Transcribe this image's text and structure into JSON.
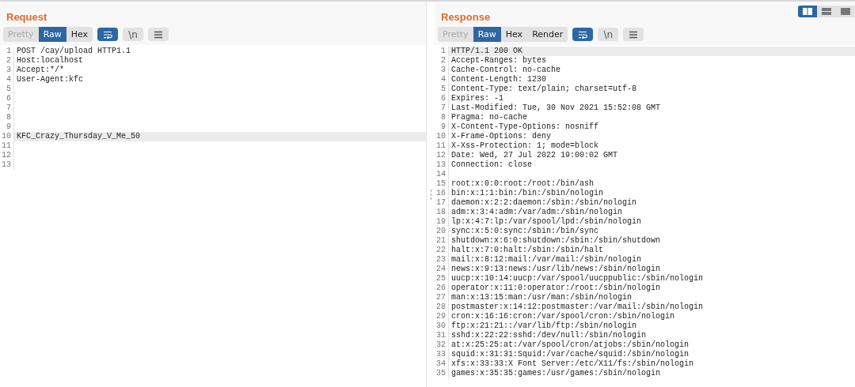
{
  "layout_buttons": [
    {
      "kind": "columns",
      "selected": true
    },
    {
      "kind": "rows",
      "selected": false
    },
    {
      "kind": "single",
      "selected": false
    }
  ],
  "panes": [
    {
      "title": "Request",
      "view_tabs": [
        {
          "label": "Pretty",
          "selected": false,
          "disabled": true
        },
        {
          "label": "Raw",
          "selected": true,
          "disabled": false
        },
        {
          "label": "Hex",
          "selected": false,
          "disabled": false
        }
      ],
      "tools": [
        {
          "kind": "wrap",
          "selected": true
        },
        {
          "kind": "newline",
          "label": "\\n",
          "selected": false
        },
        {
          "kind": "menu",
          "selected": false
        }
      ],
      "lines": [
        {
          "number": "1",
          "text": "POST /cay/upload HTTP1.1",
          "highlighted": false
        },
        {
          "number": "2",
          "text": "Host:localhost",
          "highlighted": false
        },
        {
          "number": "3",
          "text": "Accept:*/*",
          "highlighted": false
        },
        {
          "number": "4",
          "text": "User-Agent:kfc",
          "highlighted": false
        },
        {
          "number": "5",
          "highlighted": false
        },
        {
          "number": "6",
          "highlighted": false
        },
        {
          "number": "7",
          "highlighted": false
        },
        {
          "number": "8",
          "highlighted": false
        },
        {
          "number": "9",
          "highlighted": false
        },
        {
          "number": "10",
          "text": "KFC_Crazy_Thursday_V_Me_50",
          "highlighted": true
        },
        {
          "number": "11",
          "highlighted": false
        },
        {
          "number": "12",
          "highlighted": false
        },
        {
          "number": "13",
          "highlighted": false
        }
      ]
    },
    {
      "title": "Response",
      "view_tabs": [
        {
          "label": "Pretty",
          "selected": false,
          "disabled": true
        },
        {
          "label": "Raw",
          "selected": true,
          "disabled": false
        },
        {
          "label": "Hex",
          "selected": false,
          "disabled": false
        },
        {
          "label": "Render",
          "selected": false,
          "disabled": false
        }
      ],
      "tools": [
        {
          "kind": "wrap",
          "selected": true
        },
        {
          "kind": "newline",
          "label": "\\n",
          "selected": false
        },
        {
          "kind": "menu",
          "selected": false
        }
      ],
      "lines": [
        {
          "number": "1",
          "text": "HTTP/1.1 200 OK",
          "highlighted": true
        },
        {
          "number": "2",
          "text": "Accept-Ranges: bytes",
          "highlighted": false
        },
        {
          "number": "3",
          "text": "Cache-Control: no-cache",
          "highlighted": false
        },
        {
          "number": "4",
          "text": "Content-Length: 1230",
          "highlighted": false
        },
        {
          "number": "5",
          "text": "Content-Type: text/plain; charset=utf-8",
          "highlighted": false
        },
        {
          "number": "6",
          "text": "Expires: -1",
          "highlighted": false
        },
        {
          "number": "7",
          "text": "Last-Modified: Tue, 30 Nov 2021 15:52:08 GMT",
          "highlighted": false
        },
        {
          "number": "8",
          "text": "Pragma: no-cache",
          "highlighted": false
        },
        {
          "number": "9",
          "text": "X-Content-Type-Options: nosniff",
          "highlighted": false
        },
        {
          "number": "10",
          "text": "X-Frame-Options: deny",
          "highlighted": false
        },
        {
          "number": "11",
          "text": "X-Xss-Protection: 1; mode=block",
          "highlighted": false
        },
        {
          "number": "12",
          "text": "Date: Wed, 27 Jul 2022 19:00:02 GMT",
          "highlighted": false
        },
        {
          "number": "13",
          "text": "Connection: close",
          "highlighted": false
        },
        {
          "number": "14",
          "highlighted": false
        },
        {
          "number": "15",
          "text": "root:x:0:0:root:/root:/bin/ash",
          "highlighted": false
        },
        {
          "number": "16",
          "text": "bin:x:1:1:bin:/bin:/sbin/nologin",
          "highlighted": false
        },
        {
          "number": "17",
          "text": "daemon:x:2:2:daemon:/sbin:/sbin/nologin",
          "highlighted": false
        },
        {
          "number": "18",
          "text": "adm:x:3:4:adm:/var/adm:/sbin/nologin",
          "highlighted": false
        },
        {
          "number": "19",
          "text": "lp:x:4:7:lp:/var/spool/lpd:/sbin/nologin",
          "highlighted": false
        },
        {
          "number": "20",
          "text": "sync:x:5:0:sync:/sbin:/bin/sync",
          "highlighted": false
        },
        {
          "number": "21",
          "text": "shutdown:x:6:0:shutdown:/sbin:/sbin/shutdown",
          "highlighted": false
        },
        {
          "number": "22",
          "text": "halt:x:7:0:halt:/sbin:/sbin/halt",
          "highlighted": false
        },
        {
          "number": "23",
          "text": "mail:x:8:12:mail:/var/mail:/sbin/nologin",
          "highlighted": false
        },
        {
          "number": "24",
          "text": "news:x:9:13:news:/usr/lib/news:/sbin/nologin",
          "highlighted": false
        },
        {
          "number": "25",
          "text": "uucp:x:10:14:uucp:/var/spool/uucppublic:/sbin/nologin",
          "highlighted": false
        },
        {
          "number": "26",
          "text": "operator:x:11:0:operator:/root:/sbin/nologin",
          "highlighted": false
        },
        {
          "number": "27",
          "text": "man:x:13:15:man:/usr/man:/sbin/nologin",
          "highlighted": false
        },
        {
          "number": "28",
          "text": "postmaster:x:14:12:postmaster:/var/mail:/sbin/nologin",
          "highlighted": false
        },
        {
          "number": "29",
          "text": "cron:x:16:16:cron:/var/spool/cron:/sbin/nologin",
          "highlighted": false
        },
        {
          "number": "30",
          "text": "ftp:x:21:21::/var/lib/ftp:/sbin/nologin",
          "highlighted": false
        },
        {
          "number": "31",
          "text": "sshd:x:22:22:sshd:/dev/null:/sbin/nologin",
          "highlighted": false
        },
        {
          "number": "32",
          "text": "at:x:25:25:at:/var/spool/cron/atjobs:/sbin/nologin",
          "highlighted": false
        },
        {
          "number": "33",
          "text": "squid:x:31:31:Squid:/var/cache/squid:/sbin/nologin",
          "highlighted": false
        },
        {
          "number": "34",
          "text": "xfs:x:33:33:X Font Server:/etc/X11/fs:/sbin/nologin",
          "highlighted": false
        },
        {
          "number": "35",
          "text": "games:x:35:35:games:/usr/games:/sbin/nologin",
          "highlighted": false
        }
      ]
    }
  ]
}
